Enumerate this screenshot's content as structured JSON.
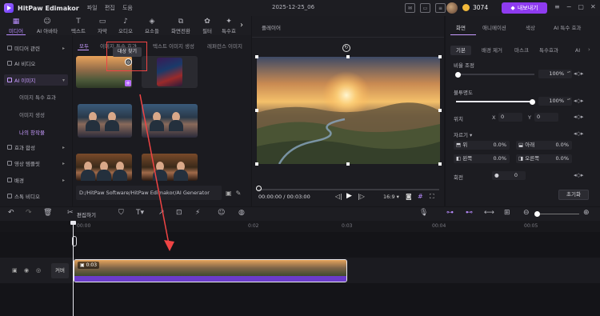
{
  "app": {
    "name": "HitPaw Edimakor",
    "doc_title": "2025-12-25_06",
    "coins": "3074",
    "upgrade_label": "내보내기"
  },
  "menu": [
    "파일",
    "편집",
    "도움"
  ],
  "toolbar": {
    "items": [
      {
        "label": "미디어",
        "icon": "media-icon",
        "active": true
      },
      {
        "label": "AI 아바타",
        "icon": "ai-avatar-icon",
        "active": false
      },
      {
        "label": "텍스트",
        "icon": "text-icon",
        "active": false
      },
      {
        "label": "자막",
        "icon": "subtitle-icon",
        "active": false
      },
      {
        "label": "오디오",
        "icon": "audio-icon",
        "active": false
      },
      {
        "label": "요소들",
        "icon": "elements-icon",
        "active": false
      },
      {
        "label": "화면전환",
        "icon": "transition-icon",
        "active": false
      },
      {
        "label": "필터",
        "icon": "filter-icon",
        "active": false
      },
      {
        "label": "특수효",
        "icon": "effects-icon",
        "active": false
      }
    ]
  },
  "sidebar": {
    "items": [
      {
        "label": "미디어 관련",
        "chev": "▸"
      },
      {
        "label": "AI 비디오",
        "chev": ""
      },
      {
        "label": "AI 이미지",
        "chev": "▾"
      },
      {
        "label": "효과 합성",
        "chev": "▸"
      },
      {
        "label": "영상 템플릿",
        "chev": "▸"
      },
      {
        "label": "배경",
        "chev": "▸"
      },
      {
        "label": "스톡 비디오",
        "chev": ""
      }
    ],
    "subitems": [
      "이미지 특수 효과",
      "이미지 생성",
      "나의 창작물"
    ]
  },
  "media": {
    "tabs": [
      "모두",
      "이미지 특수 효과",
      "텍스트 이미지 생성",
      "레퍼런스 이미지"
    ],
    "tooltip": "대상 찾기",
    "path": "D:/HitPaw Software/HitPaw Edimakor/AI Generator"
  },
  "player": {
    "title": "플레이어",
    "time": "00:00:00 / 00:03:00",
    "ratio": "16:9"
  },
  "props": {
    "tabs": [
      "화면",
      "애니메이션",
      "색상",
      "AI 특수 효과"
    ],
    "chips": [
      "기본",
      "배경 제거",
      "마스크",
      "특수효과",
      "AI"
    ],
    "opacity_label": "비율 조정",
    "opacity_value": "100%",
    "blend_label": "불투명도",
    "blend_value": "100%",
    "position_label": "위치",
    "x_label": "X",
    "x_value": "0",
    "y_label": "Y",
    "y_value": "0",
    "crop_label": "자르기 ▾",
    "crop": [
      {
        "name": "위",
        "value": "0.0%"
      },
      {
        "name": "아래",
        "value": "0.0%"
      },
      {
        "name": "왼쪽",
        "value": "0.0%"
      },
      {
        "name": "오른쪽",
        "value": "0.0%"
      }
    ],
    "rotate_label": "회전",
    "rotate_value": "0",
    "reset_label": "초기화"
  },
  "timeline": {
    "edit_label": "편집하기",
    "ticks": [
      "00:00",
      "0:02",
      "0:03",
      "00:04",
      "00:05"
    ],
    "track_label": "커버",
    "clip_time": "0:03"
  },
  "colors": {
    "accent": "#b98cff",
    "annotation": "#ef4444",
    "upgrade": "#8e3bf0",
    "clip": "#6a3cc9"
  }
}
